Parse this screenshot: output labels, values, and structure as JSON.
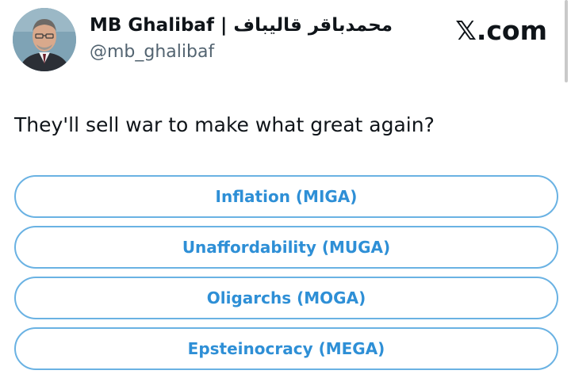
{
  "author": {
    "name": "MB Ghalibaf | محمدباقر قالیباف",
    "handle": "@mb_ghalibaf"
  },
  "brand": "𝕏.com",
  "post": {
    "text": "They'll sell war to make what great again?"
  },
  "poll": {
    "options": [
      {
        "label": "Inflation (MIGA)"
      },
      {
        "label": "Unaffordability (MUGA)"
      },
      {
        "label": "Oligarchs (MOGA)"
      },
      {
        "label": "Epsteinocracy (MEGA)"
      }
    ]
  },
  "colors": {
    "poll_border": "#6ab2e3",
    "poll_text": "#2e8fd6",
    "handle_text": "#536471",
    "primary_text": "#0f1419"
  },
  "icons": {
    "avatar": "profile-photo"
  }
}
